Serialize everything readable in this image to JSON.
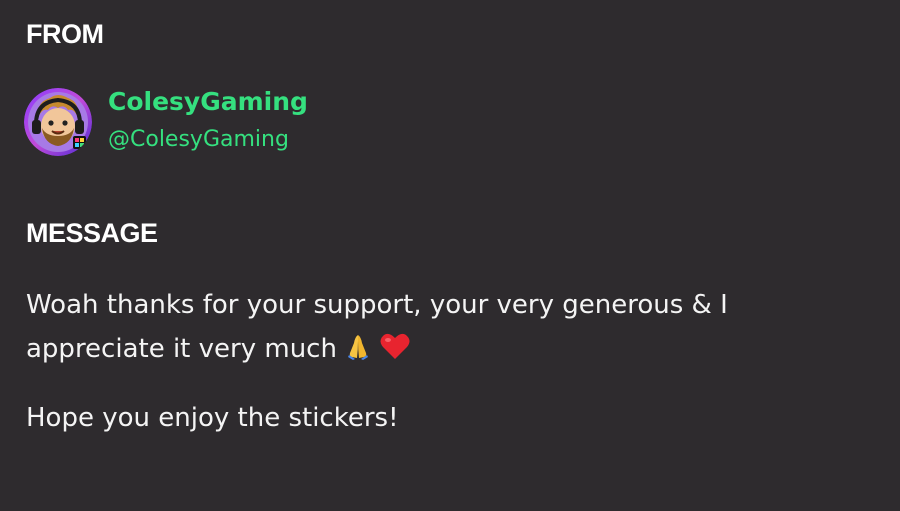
{
  "from": {
    "label": "FROM",
    "sender": {
      "display_name": "ColesyGaming",
      "handle": "@ColesyGaming",
      "avatar_icon": "cartoon-gamer-avatar",
      "name_color": "#35e07f"
    }
  },
  "message": {
    "label": "MESSAGE",
    "line1": "Woah thanks for your support, your very generous & I appreciate it very much",
    "emojis": [
      "folded-hands-icon",
      "red-heart-icon"
    ],
    "line2": "Hope you enjoy the stickers!"
  },
  "colors": {
    "background": "#2e2b2e",
    "text": "#f4f4f4",
    "accent": "#35e07f"
  }
}
